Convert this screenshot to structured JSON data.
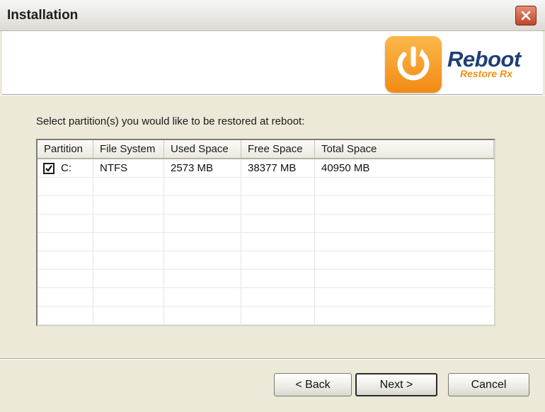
{
  "window": {
    "title": "Installation"
  },
  "banner": {
    "brand_name": "Reboot",
    "brand_sub": "Restore Rx",
    "logo_icon": "power-refresh-icon",
    "accent_color": "#f28a14",
    "brand_color": "#1f3f75"
  },
  "main": {
    "instruction": "Select partition(s) you would like to be restored at reboot:",
    "columns": [
      "Partition",
      "File System",
      "Used Space",
      "Free Space",
      "Total Space"
    ],
    "rows": [
      {
        "checked": true,
        "partition": "C:",
        "file_system": "NTFS",
        "used": "2573 MB",
        "free": "38377 MB",
        "total": "40950 MB"
      }
    ]
  },
  "footer": {
    "back_label": "< Back",
    "next_label": "Next >",
    "cancel_label": "Cancel"
  }
}
